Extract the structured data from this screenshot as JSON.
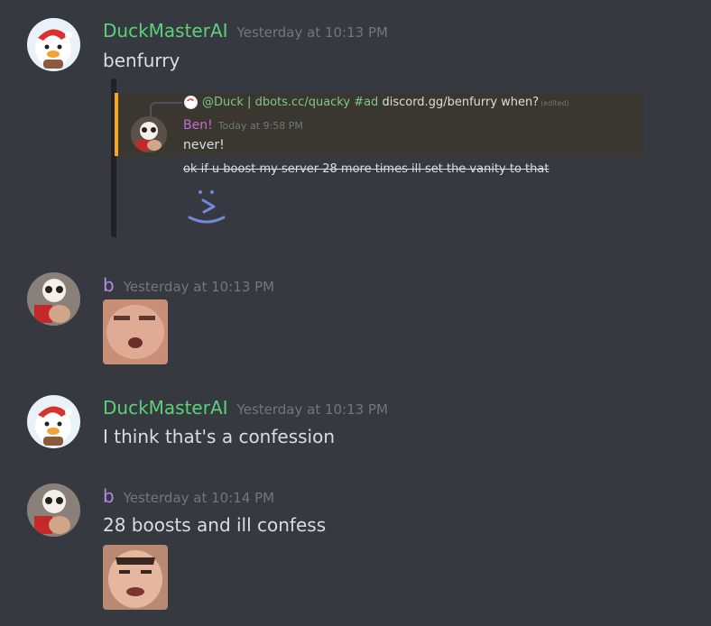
{
  "colors": {
    "background": "#36393f",
    "duck_name": "#5cd17a",
    "ben_name": "#b488e6",
    "timestamp": "#72767d",
    "text": "#dcddde",
    "quote_accent": "#faa61a"
  },
  "messages": [
    {
      "author": "DuckMasterAI",
      "timestamp": "Yesterday at 10:13 PM",
      "text": "benfurry",
      "avatar_icon": "snowman-duck-avatar",
      "embed": {
        "reply_mention": "@Duck | dbots.cc/quacky #ad",
        "reply_text": "discord.gg/benfurry when?",
        "reply_edited": "(edited)",
        "quoted_author": "Ben!",
        "quoted_time": "Today at 9:58 PM",
        "quoted_line1": "never!",
        "quoted_line2": "ok if u boost my server 28 more times ill set the vanity to that",
        "emoji_icon": "smirk-face-emoji"
      }
    },
    {
      "author": "b",
      "timestamp": "Yesterday at 10:13 PM",
      "avatar_icon": "panda-hat-avatar",
      "emote_icon": "face-emote"
    },
    {
      "author": "DuckMasterAI",
      "timestamp": "Yesterday at 10:13 PM",
      "text": "I think that's a confession",
      "avatar_icon": "snowman-duck-avatar"
    },
    {
      "author": "b",
      "timestamp": "Yesterday at 10:14 PM",
      "text": "28 boosts and ill confess",
      "avatar_icon": "panda-hat-avatar",
      "emote_icon": "face-emote"
    }
  ]
}
